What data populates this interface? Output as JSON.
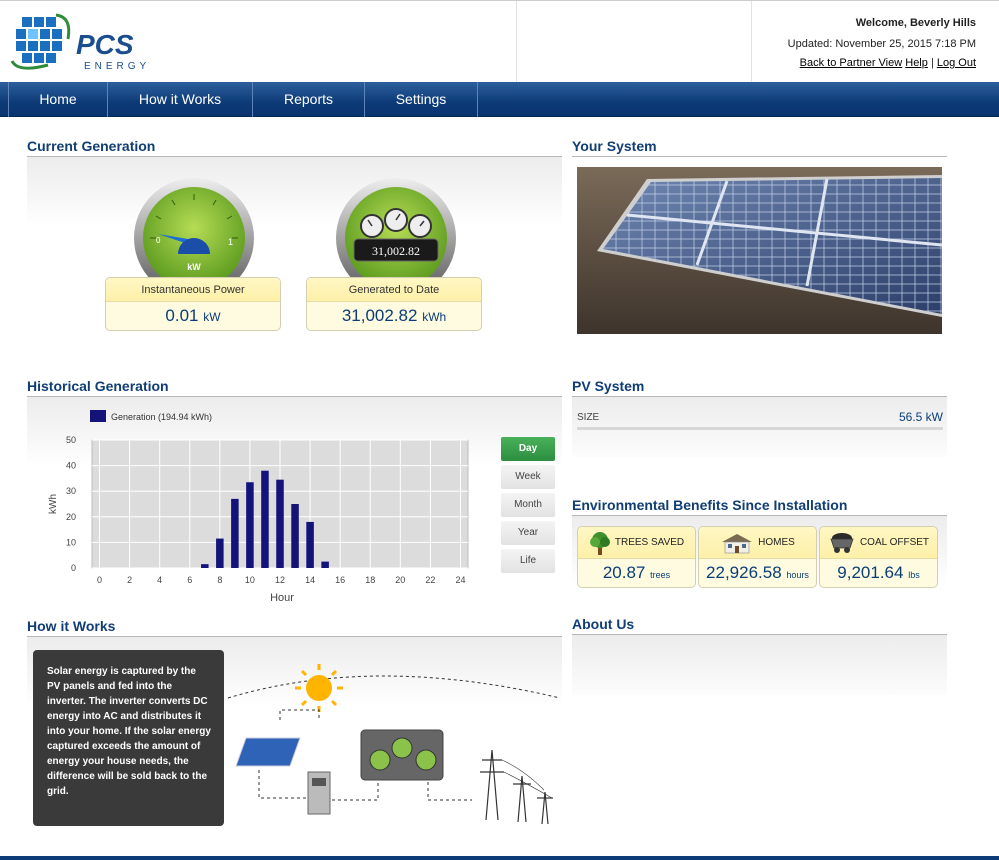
{
  "brand": {
    "name": "PCS",
    "tagline": "ENERGY"
  },
  "header": {
    "welcome": "Welcome, Beverly Hills",
    "updated": "Updated: November 25, 2015 7:18 PM",
    "links": {
      "back": "Back to Partner View",
      "help": "Help",
      "separator": "|",
      "logout": "Log Out"
    }
  },
  "nav": [
    "Home",
    "How it Works",
    "Reports",
    "Settings"
  ],
  "current_generation": {
    "title": "Current Generation",
    "gauge": {
      "min_label": "0",
      "max_label": "1",
      "unit": "kW"
    },
    "odometer": "31,002.82",
    "instantaneous": {
      "label": "Instantaneous Power",
      "value": "0.01",
      "unit": "kW"
    },
    "to_date": {
      "label": "Generated to Date",
      "value": "31,002.82",
      "unit": "kWh"
    }
  },
  "your_system": {
    "title": "Your System"
  },
  "historical": {
    "title": "Historical Generation",
    "periods": [
      "Day",
      "Week",
      "Month",
      "Year",
      "Life"
    ],
    "active_period": "Day"
  },
  "chart_data": {
    "type": "bar",
    "x": [
      7,
      8,
      9,
      10,
      11,
      12,
      13,
      14,
      15
    ],
    "series": [
      {
        "name": "Generation (194.94 kWh)",
        "values": [
          1.5,
          11.5,
          27,
          33.5,
          38,
          34.5,
          25,
          18,
          2.5
        ],
        "color": "#13137a"
      }
    ],
    "xlabel": "Hour",
    "ylabel": "kWh",
    "xlim": [
      -0.5,
      24.5
    ],
    "ylim": [
      0,
      50
    ],
    "xticks": [
      0,
      2,
      4,
      6,
      8,
      10,
      12,
      14,
      16,
      18,
      20,
      22,
      24
    ],
    "yticks": [
      0,
      10,
      20,
      30,
      40,
      50
    ],
    "grid": true,
    "legend": "top-left"
  },
  "pv_system": {
    "title": "PV System",
    "size_label": "SIZE",
    "size_value": "56.5 kW"
  },
  "environment": {
    "title": "Environmental Benefits Since Installation",
    "items": [
      {
        "label": "TREES SAVED",
        "value": "20.87",
        "unit": "trees",
        "icon": "tree-icon"
      },
      {
        "label": "HOMES",
        "value": "22,926.58",
        "unit": "hours",
        "icon": "house-icon"
      },
      {
        "label": "COAL OFFSET",
        "value": "9,201.64",
        "unit": "lbs",
        "icon": "coal-cart-icon"
      }
    ]
  },
  "how_it_works": {
    "title": "How it Works",
    "text": "Solar energy is captured by the PV panels and fed into the inverter. The inverter converts DC energy into AC and distributes it into your home. If the solar energy captured exceeds the amount of energy your house needs, the difference will be sold back to the grid."
  },
  "about": {
    "title": "About Us"
  },
  "colors": {
    "navy": "#0d3b78",
    "title_blue": "#103e74",
    "accent_green": "#2c8e40",
    "bar": "#13137a"
  }
}
